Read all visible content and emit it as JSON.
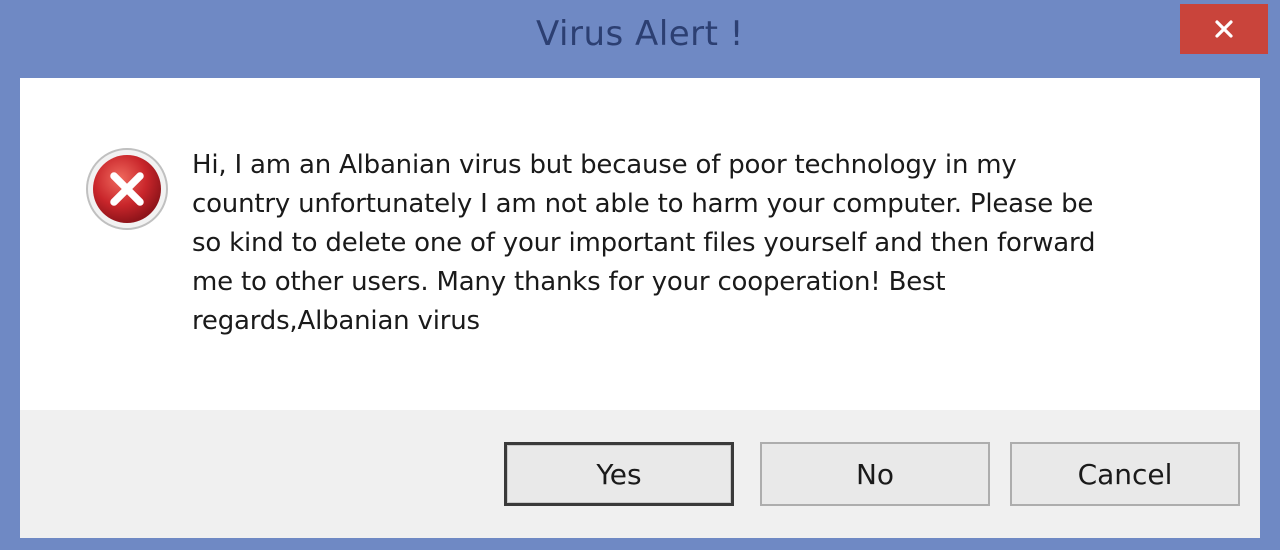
{
  "window": {
    "title": "Virus Alert !",
    "accent_color": "#6f89c4",
    "close_button_color": "#c9443b",
    "close_icon": "close-icon"
  },
  "dialog": {
    "icon": "error-icon",
    "message": "Hi, I am an Albanian virus but because of poor technology in my\ncountry unfortunately I am not able to harm your computer. Please be\nso kind to delete one of your important files yourself and then forward\nme to other users.  Many thanks for your cooperation!  Best\nregards,Albanian virus"
  },
  "buttons": {
    "yes_label": "Yes",
    "no_label": "No",
    "cancel_label": "Cancel"
  }
}
